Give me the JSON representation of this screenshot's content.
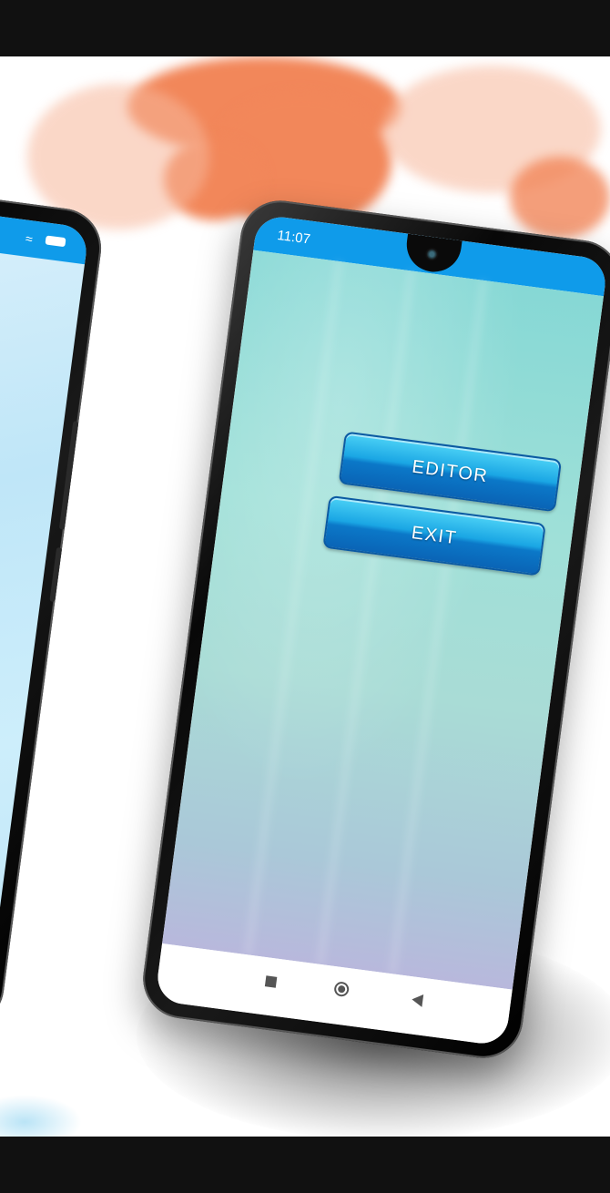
{
  "status_bar": {
    "time": "11:07"
  },
  "menu": {
    "editor_label": "EDITOR",
    "exit_label": "EXIT"
  },
  "colors": {
    "status_bar": "#0f9bea",
    "button": "#1aa6e4",
    "splash": "#f2875a"
  },
  "icons": {
    "left_status": [
      "wifi-icon",
      "battery-icon"
    ],
    "nav": [
      "recents-icon",
      "home-icon",
      "back-icon"
    ]
  }
}
